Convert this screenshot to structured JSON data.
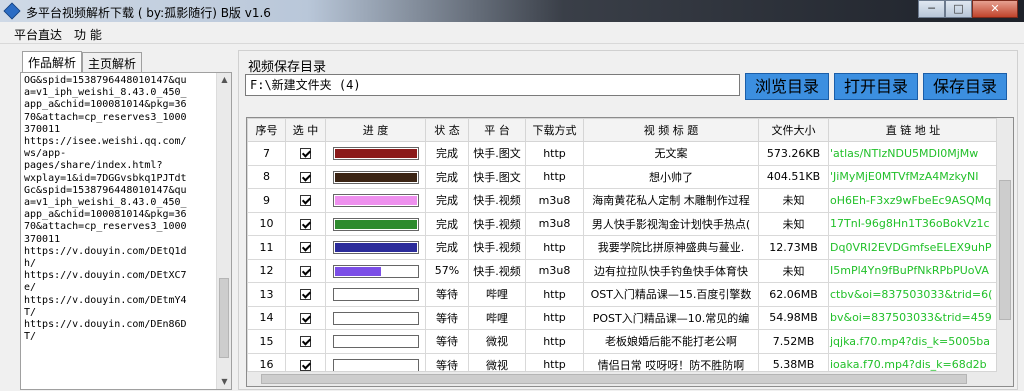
{
  "window": {
    "title": "多平台视频解析下载 ( by:孤影随行) B版 v1.6",
    "min": "─",
    "max": "□",
    "close": "✕"
  },
  "menu": [
    "平台直达",
    "功 能"
  ],
  "tabs": [
    "作品解析",
    "主页解析"
  ],
  "left_text": "OG&spid=1538796448010147&qu\na=v1_iph_weishi_8.43.0_450_\napp_a&chid=100081014&pkg=36\n70&attach=cp_reserves3_1000\n370011\nhttps://isee.weishi.qq.com/\nws/app-\npages/share/index.html?\nwxplay=1&id=7DGGvsbkq1PJTdt\nGc&spid=1538796448010147&qu\na=v1_iph_weishi_8.43.0_450_\napp_a&chid=100081014&pkg=36\n70&attach=cp_reserves3_1000\n370011\nhttps://v.douyin.com/DEtQ1d\nh/\nhttps://v.douyin.com/DEtXC7\ne/\nhttps://v.douyin.com/DEtmY4\nT/\nhttps://v.douyin.com/DEn86D\nT/",
  "save": {
    "label": "视频保存目录",
    "path": "F:\\新建文件夹 (4)"
  },
  "buttons": {
    "browse": "浏览目录",
    "open": "打开目录",
    "save": "保存目录"
  },
  "columns": [
    "序号",
    "选 中",
    "进 度",
    "状 态",
    "平 台",
    "下载方式",
    "视 频 标 题",
    "文件大小",
    "直 链 地 址"
  ],
  "rows": [
    {
      "no": "7",
      "progress": 1.0,
      "color": "#8b1a1a",
      "status": "完成",
      "platform": "快手.图文",
      "method": "http",
      "title": "无文案",
      "size": "573.26KB",
      "link": "'atlas/NTIzNDU5MDI0MjMw"
    },
    {
      "no": "8",
      "progress": 1.0,
      "color": "#3b2414",
      "status": "完成",
      "platform": "快手.图文",
      "method": "http",
      "title": "想小帅了",
      "size": "404.51KB",
      "link": "'JiMyMjE0MTVfMzA4MzkyNI"
    },
    {
      "no": "9",
      "progress": 1.0,
      "color": "#ee90ee",
      "status": "完成",
      "platform": "快手.视频",
      "method": "m3u8",
      "title": "海南黄花私人定制 木雕制作过程",
      "size": "未知",
      "link": "oH6Eh-F3xz9wFbeEc9ASQMq"
    },
    {
      "no": "10",
      "progress": 1.0,
      "color": "#2e8b2e",
      "status": "完成",
      "platform": "快手.视频",
      "method": "m3u8",
      "title": "男人快手影视淘金计划快手热点(",
      "size": "未知",
      "link": "17TnI-96g8Hn1T36oBokVz1c"
    },
    {
      "no": "11",
      "progress": 1.0,
      "color": "#2b2b9a",
      "status": "完成",
      "platform": "快手.视频",
      "method": "http",
      "title": "我要学院比拼原神盛典与蔓业.",
      "size": "12.73MB",
      "link": "Dq0VRI2EVDGmfseELEX9uhP"
    },
    {
      "no": "12",
      "progress": 0.57,
      "color": "#7b4ee6",
      "status": "57%",
      "platform": "快手.视频",
      "method": "m3u8",
      "title": "边有拉拉队快手钓鱼快手体育快",
      "size": "未知",
      "link": "I5mPl4Yn9fBuPfNkRPbPUoVA"
    },
    {
      "no": "13",
      "progress": 0.0,
      "color": "#cccccc",
      "status": "等待",
      "platform": "哔哩",
      "method": "http",
      "title": "OST入门精品课—15.百度引擎数",
      "size": "62.06MB",
      "link": "ctbv&oi=837503033&trid=6("
    },
    {
      "no": "14",
      "progress": 0.0,
      "color": "#cccccc",
      "status": "等待",
      "platform": "哔哩",
      "method": "http",
      "title": "POST入门精品课—10.常见的编",
      "size": "54.98MB",
      "link": "bv&oi=837503033&trid=459"
    },
    {
      "no": "15",
      "progress": 0.0,
      "color": "#cccccc",
      "status": "等待",
      "platform": "微视",
      "method": "http",
      "title": "老板娘婚后能不能打老公啊",
      "size": "7.52MB",
      "link": "jqjka.f70.mp4?dis_k=5005ba"
    },
    {
      "no": "16",
      "progress": 0.0,
      "color": "#cccccc",
      "status": "等待",
      "platform": "微视",
      "method": "http",
      "title": "情侣日常 哎呀呀！防不胜防啊",
      "size": "5.38MB",
      "link": "ioaka.f70.mp4?dis_k=68d2b"
    }
  ]
}
